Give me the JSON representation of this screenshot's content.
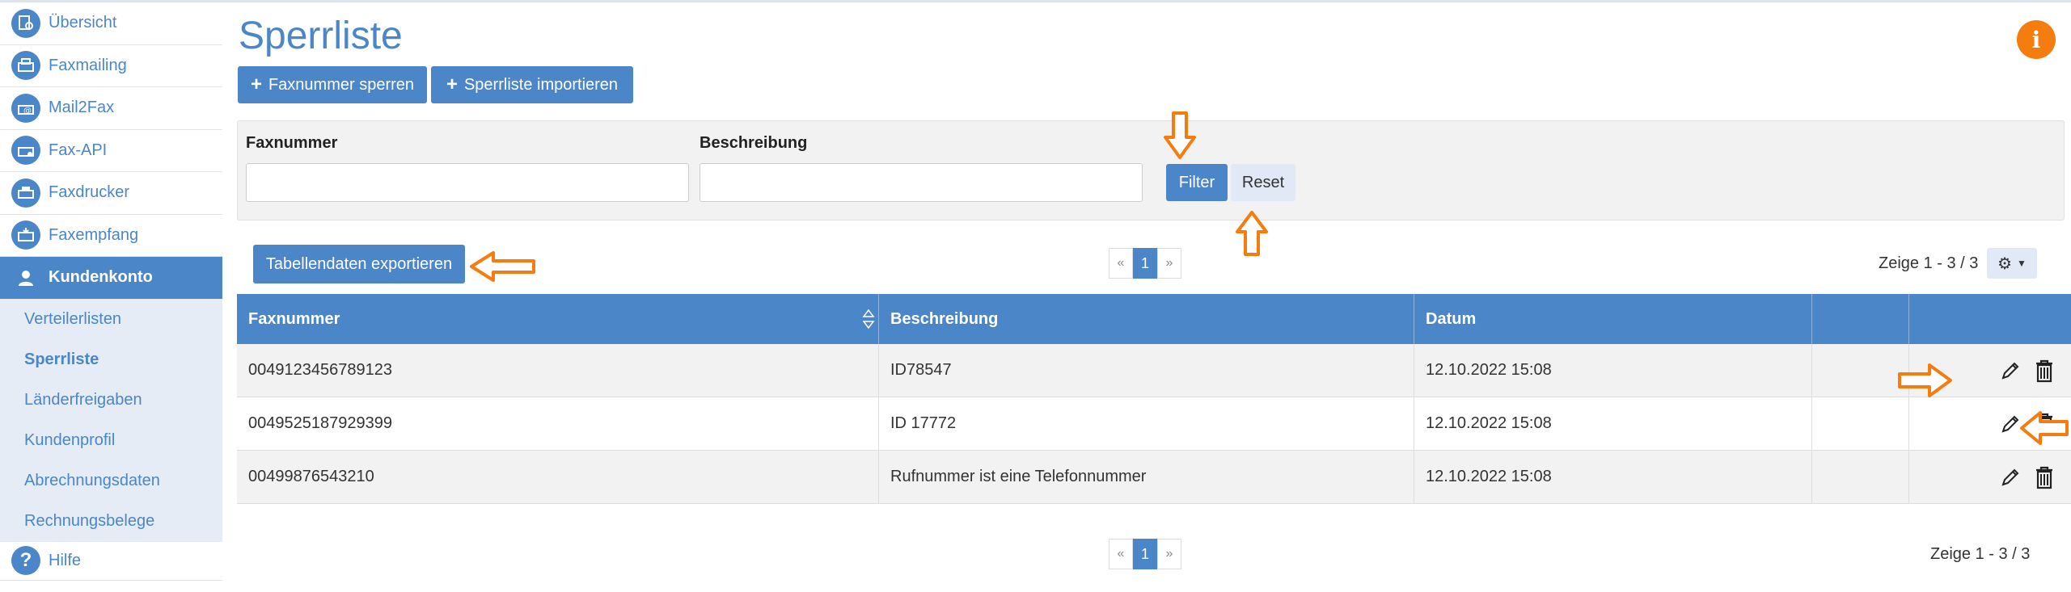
{
  "sidebar": {
    "items": [
      {
        "label": "Übersicht",
        "icon": "overview-icon"
      },
      {
        "label": "Faxmailing",
        "icon": "faxmailing-icon"
      },
      {
        "label": "Mail2Fax",
        "icon": "mail2fax-icon"
      },
      {
        "label": "Fax-API",
        "icon": "fax-api-icon"
      },
      {
        "label": "Faxdrucker",
        "icon": "fax-printer-icon"
      },
      {
        "label": "Faxempfang",
        "icon": "fax-receive-icon"
      },
      {
        "label": "Kundenkonto",
        "icon": "user-icon"
      }
    ],
    "subitems": [
      {
        "label": "Verteilerlisten"
      },
      {
        "label": "Sperrliste"
      },
      {
        "label": "Länderfreigaben"
      },
      {
        "label": "Kundenprofil"
      },
      {
        "label": "Abrechnungsdaten"
      },
      {
        "label": "Rechnungsbelege"
      }
    ],
    "help": {
      "label": "Hilfe",
      "icon": "help-icon"
    }
  },
  "header": {
    "title": "Sperrliste",
    "info_icon": "info-icon"
  },
  "toolbar": {
    "block_label": "Faxnummer sperren",
    "import_label": "Sperrliste importieren"
  },
  "filter": {
    "fax_label": "Faxnummer",
    "fax_value": "",
    "desc_label": "Beschreibung",
    "desc_value": "",
    "filter_label": "Filter",
    "reset_label": "Reset"
  },
  "export_label": "Tabellendaten exportieren",
  "pagination": {
    "prev": "«",
    "current": "1",
    "next": "»",
    "count_top": "Zeige 1 - 3 / 3",
    "count_bottom": "Zeige 1 - 3 / 3"
  },
  "table": {
    "headers": [
      "Faxnummer",
      "Beschreibung",
      "Datum",
      "",
      ""
    ],
    "rows": [
      {
        "fax": "0049123456789123",
        "desc": "ID78547",
        "date": "12.10.2022 15:08"
      },
      {
        "fax": "0049525187929399",
        "desc": "ID 17772",
        "date": "12.10.2022 15:08"
      },
      {
        "fax": "00499876543210",
        "desc": "Rufnummer ist eine Telefonnummer",
        "date": "12.10.2022 15:08"
      }
    ]
  },
  "colors": {
    "brand_blue": "#4a86c8",
    "annotation_orange": "#f57c0f"
  }
}
